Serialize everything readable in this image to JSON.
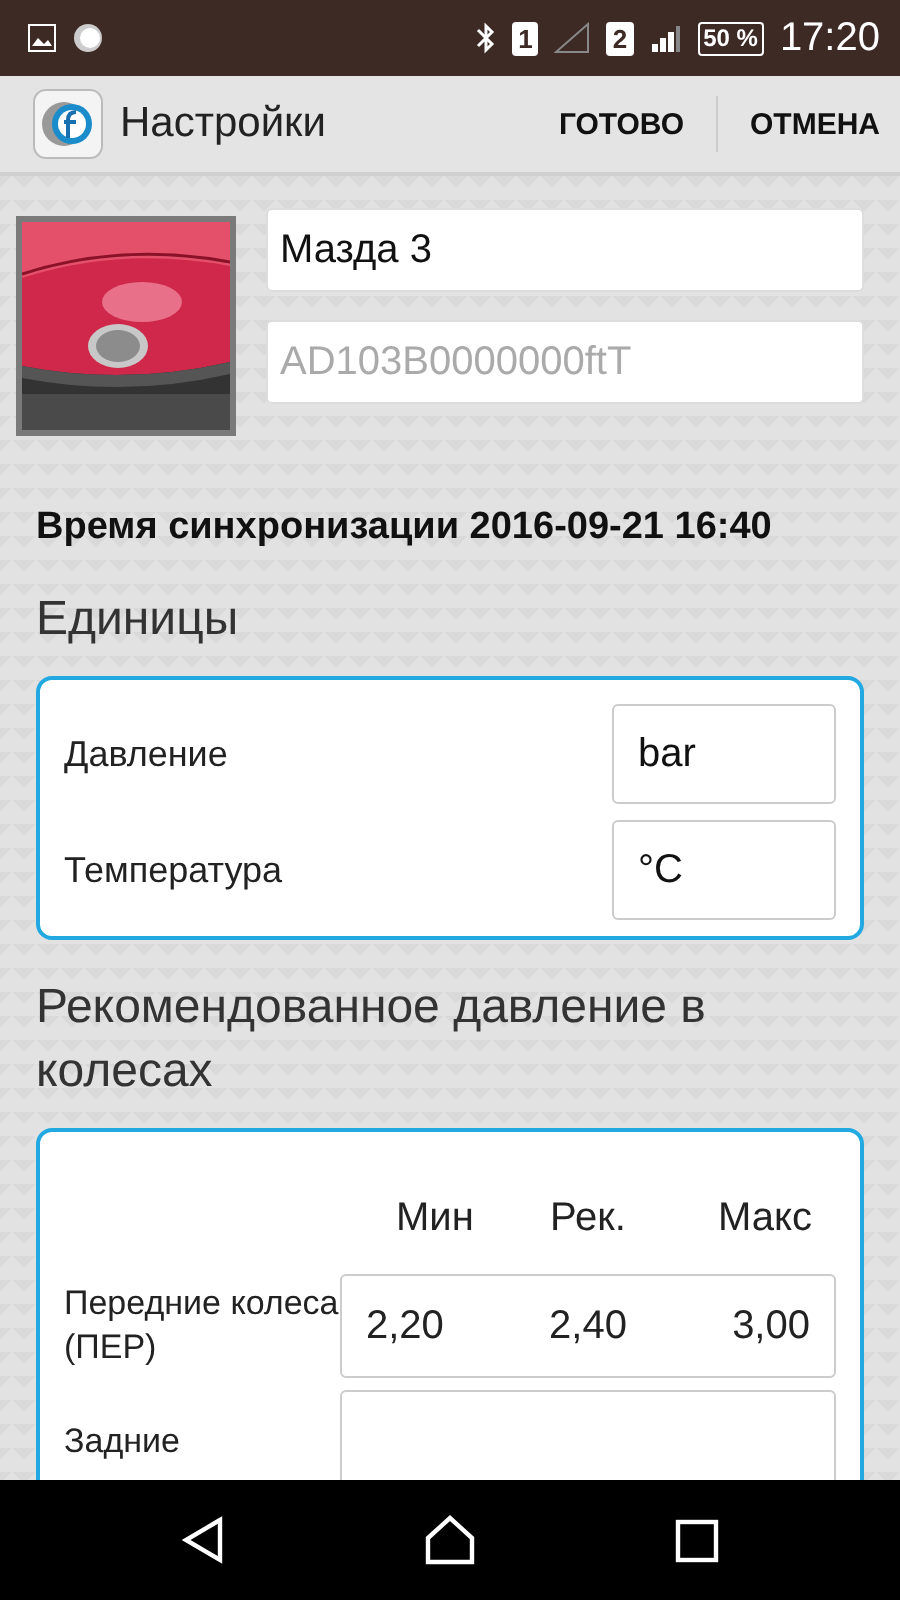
{
  "status_bar": {
    "sim1": "1",
    "sim2": "2",
    "battery": "50 %",
    "time": "17:20"
  },
  "action_bar": {
    "title": "Настройки",
    "buttons": [
      "ГОТОВО",
      "ОТМЕНА"
    ]
  },
  "car": {
    "name": "Мазда 3",
    "id_placeholder": "AD103B0000000ftT"
  },
  "sync_text": "Время синхронизации 2016-09-21 16:40",
  "units": {
    "heading": "Единицы",
    "rows": [
      {
        "label": "Давление",
        "value": "bar"
      },
      {
        "label": "Температура",
        "value": "°C"
      }
    ]
  },
  "pressure": {
    "heading": "Рекомендованное давление в колесах",
    "columns": [
      "Мин",
      "Рек.",
      "Макс"
    ],
    "rows": [
      {
        "label": "Передние колеса (ПЕР)",
        "values": [
          "2,20",
          "2,40",
          "3,00"
        ]
      },
      {
        "label": "Задние",
        "values": []
      }
    ]
  }
}
